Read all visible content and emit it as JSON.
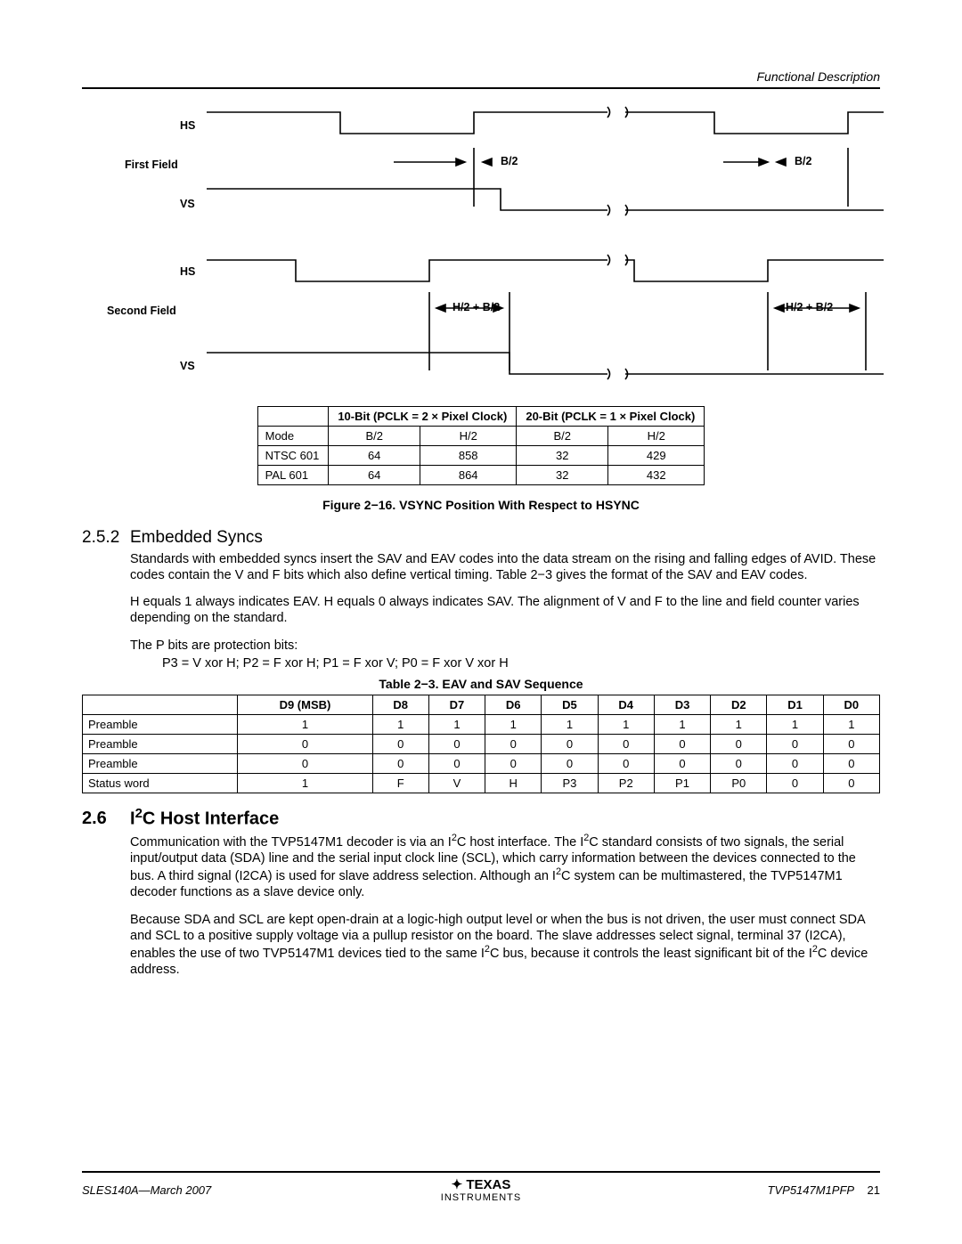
{
  "header_right": "Functional Description",
  "diagram": {
    "first_field_label": "First Field",
    "second_field_label": "Second Field",
    "hs_label": "HS",
    "vs_label": "VS",
    "b2_label": "B/2",
    "h2b2_label": "H/2 + B/2"
  },
  "table1": {
    "col10": "10-Bit (PCLK = 2 × Pixel Clock)",
    "col20": "20-Bit (PCLK = 1 × Pixel Clock)",
    "rows": [
      {
        "c0": "Mode",
        "c1": "B/2",
        "c2": "H/2",
        "c3": "B/2",
        "c4": "H/2"
      },
      {
        "c0": "NTSC 601",
        "c1": "64",
        "c2": "858",
        "c3": "32",
        "c4": "429"
      },
      {
        "c0": "PAL 601",
        "c1": "64",
        "c2": "864",
        "c3": "32",
        "c4": "432"
      }
    ]
  },
  "figcaption": "Figure 2−16. VSYNC Position With Respect to HSYNC",
  "sec252_num": "2.5.2",
  "sec252_title": "Embedded Syncs",
  "sec252_p1": "Standards with embedded syncs insert the SAV and EAV codes into the data stream on the rising and falling edges of AVID. These codes contain the V and F bits which also define vertical timing. Table 2−3 gives the format of the SAV and EAV codes.",
  "sec252_p2": "H equals 1 always indicates EAV. H equals 0 always indicates SAV. The alignment of V and F to the line and field counter varies depending on the standard.",
  "sec252_p3": "The P bits are protection bits:",
  "sec252_p4": "P3 = V xor H; P2 = F xor H; P1 = F xor V; P0 = F xor V xor H",
  "table2_caption": "Table 2−3. EAV and SAV Sequence",
  "table2": {
    "headers": [
      "",
      "D9 (MSB)",
      "D8",
      "D7",
      "D6",
      "D5",
      "D4",
      "D3",
      "D2",
      "D1",
      "D0"
    ],
    "rows": [
      {
        "label": "Preamble",
        "d": [
          "1",
          "1",
          "1",
          "1",
          "1",
          "1",
          "1",
          "1",
          "1",
          "1"
        ]
      },
      {
        "label": "Preamble",
        "d": [
          "0",
          "0",
          "0",
          "0",
          "0",
          "0",
          "0",
          "0",
          "0",
          "0"
        ]
      },
      {
        "label": "Preamble",
        "d": [
          "0",
          "0",
          "0",
          "0",
          "0",
          "0",
          "0",
          "0",
          "0",
          "0"
        ]
      },
      {
        "label": "Status word",
        "d": [
          "1",
          "F",
          "V",
          "H",
          "P3",
          "P2",
          "P1",
          "P0",
          "0",
          "0"
        ]
      }
    ]
  },
  "sec26_num": "2.6",
  "sec26_title_pre": "I",
  "sec26_title_sup": "2",
  "sec26_title_post": "C Host Interface",
  "sec26_p1a": "Communication with the TVP5147M1 decoder is via an I",
  "sec26_p1b": "C host interface. The I",
  "sec26_p1c": "C standard consists of two signals, the serial input/output data (SDA) line and the serial input clock line (SCL), which carry information between the devices connected to the bus. A third signal (I2CA) is used for slave address selection. Although an I",
  "sec26_p1d": "C system can be multimastered, the TVP5147M1 decoder functions as a slave device only.",
  "sec26_p2a": "Because SDA and SCL are kept open-drain at a logic-high output level or when the bus is not driven, the user must connect SDA and SCL to a positive supply voltage via a pullup resistor on the board. The slave addresses select signal, terminal 37 (I2CA), enables the use of two TVP5147M1 devices tied to the same I",
  "sec26_p2b": "C bus, because it controls the least significant bit of the I",
  "sec26_p2c": "C device address.",
  "footer": {
    "left": "SLES140A—March 2007",
    "brand_top": "TEXAS",
    "brand_bot": "INSTRUMENTS",
    "right_part": "TVP5147M1PFP",
    "right_page": "21"
  }
}
